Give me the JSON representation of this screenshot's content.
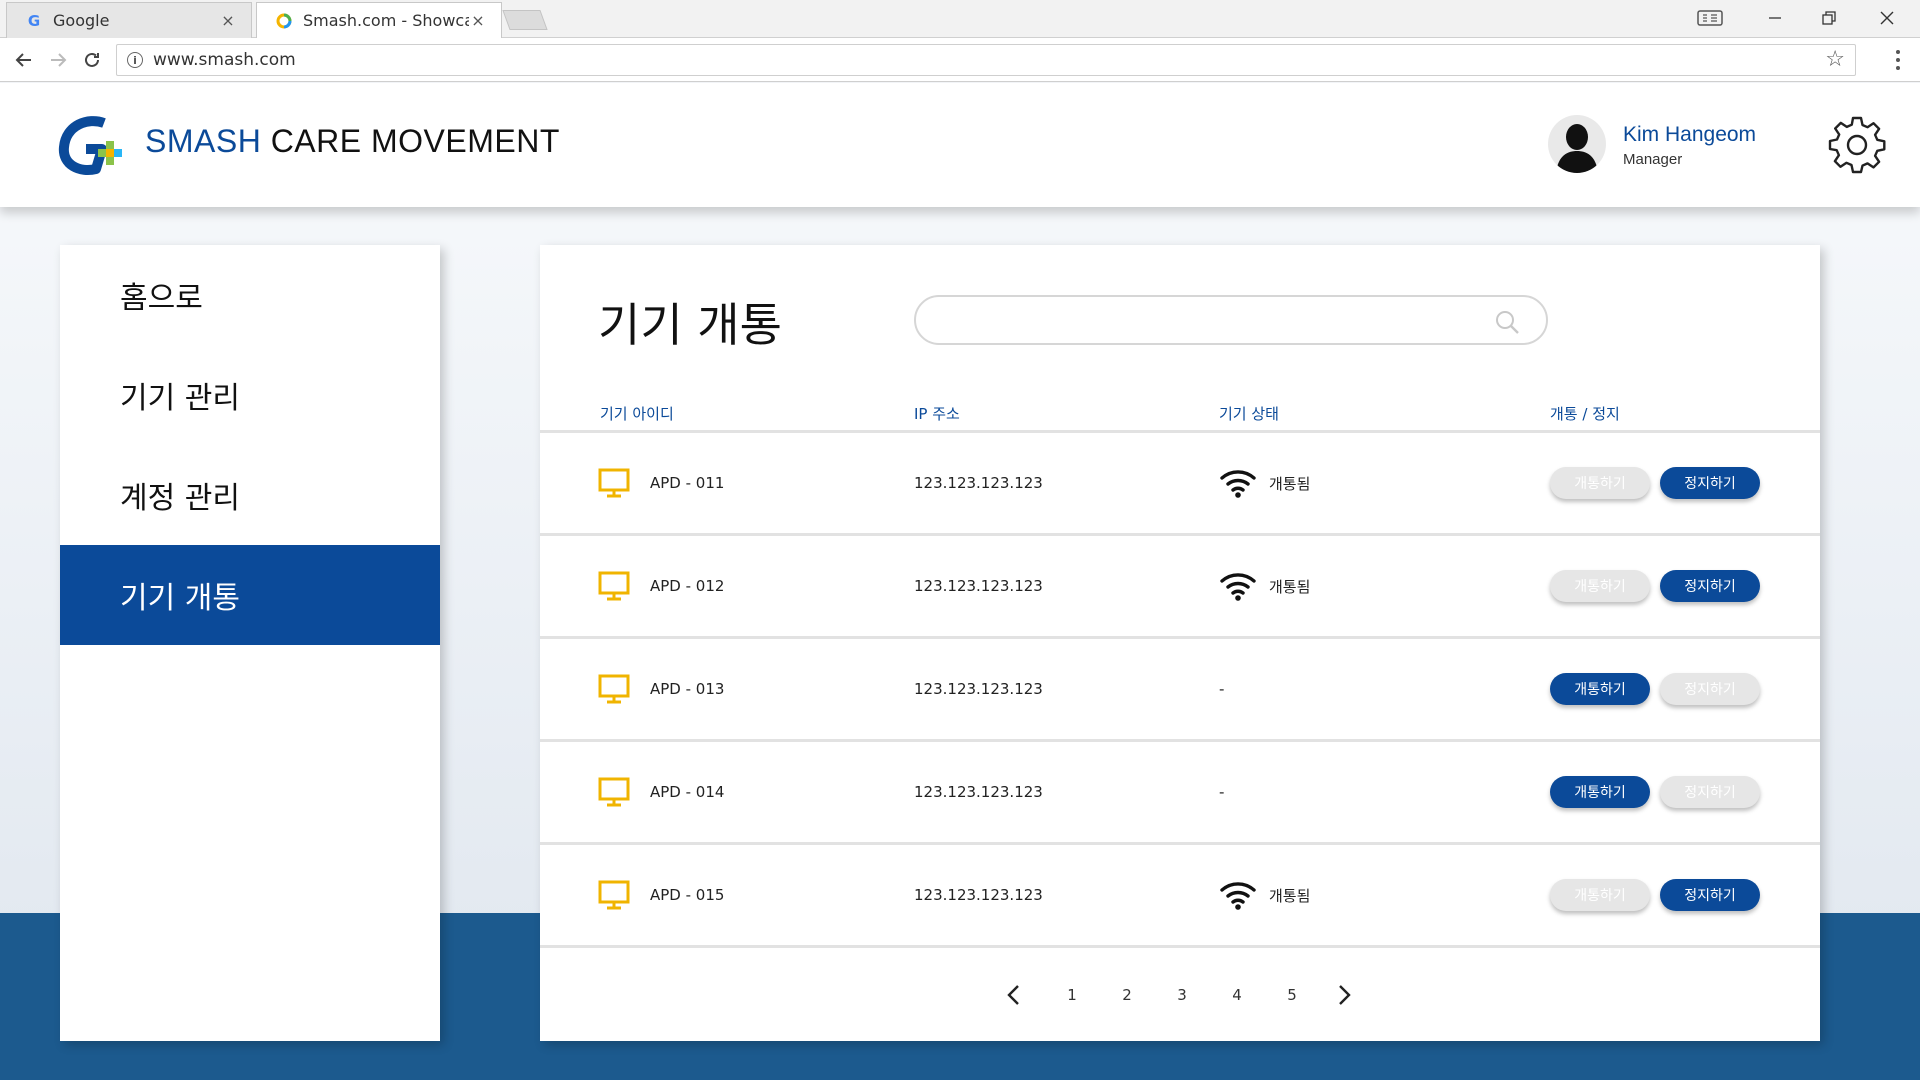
{
  "browser": {
    "tabs": [
      {
        "title": "Google",
        "favicon": "G"
      },
      {
        "title": "Smash.com - Showcasin",
        "favicon": "chrome-dot"
      }
    ],
    "tab_close": "×",
    "window_badge": "",
    "url": "www.smash.com"
  },
  "header": {
    "brand_part1": "SMASH",
    "brand_part2": " CARE MOVEMENT",
    "user_name": "Kim Hangeom",
    "user_role": "Manager"
  },
  "sidebar": {
    "items": [
      {
        "label": "홈으로"
      },
      {
        "label": "기기 관리"
      },
      {
        "label": "계정 관리"
      },
      {
        "label": "기기 개통"
      }
    ],
    "active_index": 3
  },
  "main": {
    "title": "기기 개통",
    "search_placeholder": "",
    "columns": [
      "기기 아이디",
      "IP 주소",
      "기기 상태",
      "개통 / 정지"
    ],
    "activate_label": "개통하기",
    "suspend_label": "정지하기",
    "rows": [
      {
        "device_id": "APD - 011",
        "ip": "123.123.123.123",
        "status": "개통됨",
        "activated": true
      },
      {
        "device_id": "APD - 012",
        "ip": "123.123.123.123",
        "status": "개통됨",
        "activated": true
      },
      {
        "device_id": "APD - 013",
        "ip": "123.123.123.123",
        "status": "-",
        "activated": false
      },
      {
        "device_id": "APD - 014",
        "ip": "123.123.123.123",
        "status": "-",
        "activated": false
      },
      {
        "device_id": "APD - 015",
        "ip": "123.123.123.123",
        "status": "개통됨",
        "activated": true
      }
    ],
    "pages": [
      "1",
      "2",
      "3",
      "4",
      "5"
    ]
  },
  "colors": {
    "brand_blue": "#0b4a99",
    "monitor_icon": "#f0b400",
    "button_disabled": "#e6e6e6"
  }
}
